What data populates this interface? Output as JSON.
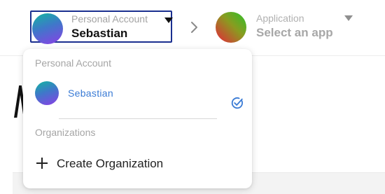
{
  "header": {
    "account": {
      "caption": "Personal Account",
      "value": "Sebastian"
    },
    "application": {
      "caption": "Application",
      "value": "Select an app"
    }
  },
  "dropdown": {
    "personal_heading": "Personal Account",
    "accounts": [
      {
        "name": "Sebastian",
        "selected": true
      }
    ],
    "organizations_heading": "Organizations",
    "create_label": "Create Organization"
  },
  "icons": {
    "breadcrumb_separator": "chevron-right-icon",
    "account_caret": "caret-down-icon",
    "app_caret": "caret-down-icon",
    "selected": "check-circle-icon",
    "create": "plus-icon"
  },
  "colors": {
    "focus_border": "#1a2f8f",
    "selected_text": "#3a7bd5",
    "muted_text": "#a5a5a5"
  }
}
